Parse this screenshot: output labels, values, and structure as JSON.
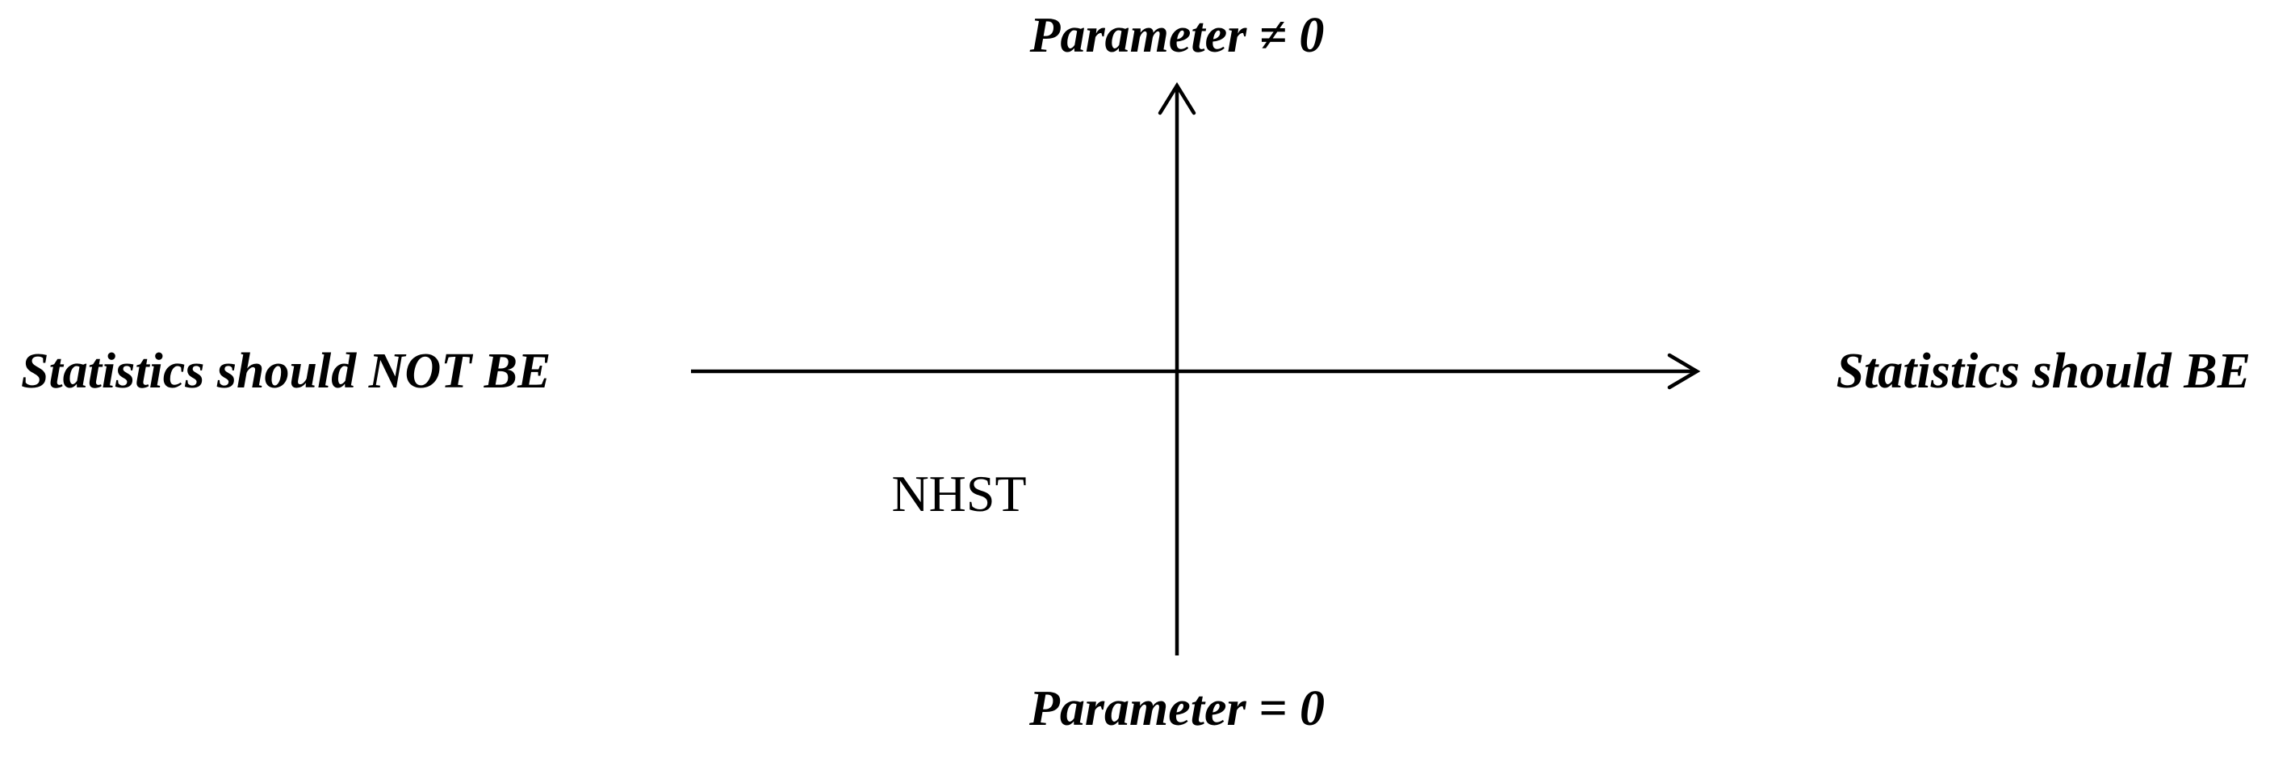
{
  "diagram": {
    "labels": {
      "top": "Parameter ≠ 0",
      "bottom": "Parameter = 0",
      "left": "Statistics should NOT BE",
      "right": "Statistics should BE"
    },
    "quadrant_labels": {
      "bottom_left": "NHST"
    },
    "colors": {
      "background": "#ffffff",
      "ink": "#000000"
    }
  }
}
